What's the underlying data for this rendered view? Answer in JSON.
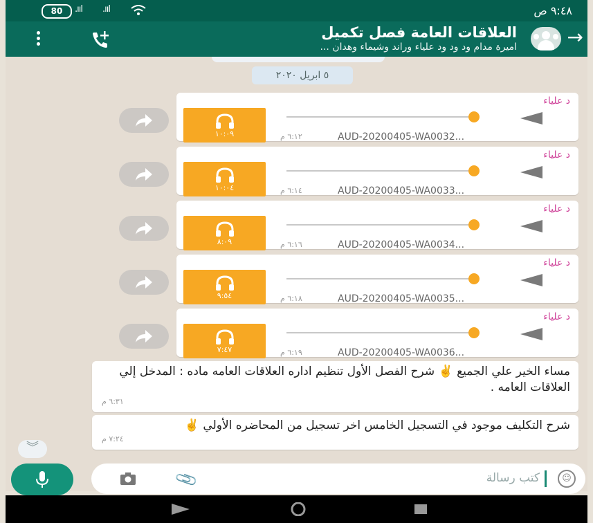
{
  "status_bar": {
    "battery": "80",
    "time": "٩:٤٨ ص"
  },
  "header": {
    "title": "العلاقات العامة فصل تكميل",
    "subtitle": "اميرة مدام ود ود ود علياء وراند وشيماء وهدان ...",
    "back_icon": "arrow-right-icon",
    "call_icon": "add-call-icon",
    "menu_icon": "more-vert-icon"
  },
  "chat": {
    "date_label": "٥ ابريل ٢٠٢٠",
    "audio_messages": [
      {
        "sender": "د علياء",
        "duration": "١٠:٠٩",
        "filename": "AUD-20200405-WA0032...",
        "time": "٦:١٢ م"
      },
      {
        "sender": "د علياء",
        "duration": "١٠:٠٤",
        "filename": "AUD-20200405-WA0033...",
        "time": "٦:١٤ م"
      },
      {
        "sender": "د علياء",
        "duration": "٨:٠٩",
        "filename": "AUD-20200405-WA0034...",
        "time": "٦:١٦ م"
      },
      {
        "sender": "د علياء",
        "duration": "٩:٥٤",
        "filename": "AUD-20200405-WA0035...",
        "time": "٦:١٨ م"
      },
      {
        "sender": "د علياء",
        "duration": "٧:٤٧",
        "filename": "AUD-20200405-WA0036...",
        "time": "٦:١٩ م"
      }
    ],
    "text_messages": [
      {
        "text": "مساء الخير علي الجميع ✌️ شرح الفصل الأول تنظيم اداره العلاقات العامه ماده : المدخل إلي العلاقات العامه .",
        "time": "٦:٣١ م"
      },
      {
        "text": "شرح التكليف موجود في التسجيل الخامس  اخر تسجيل من المحاضره الأولي ✌️",
        "time": "٧:٢٤ م"
      }
    ]
  },
  "input": {
    "placeholder": "كتب رسالة"
  },
  "colors": {
    "header": "#0a6b5b",
    "audio_thumb": "#f7a823",
    "sender": "#d0459b",
    "mic": "#14937a"
  }
}
